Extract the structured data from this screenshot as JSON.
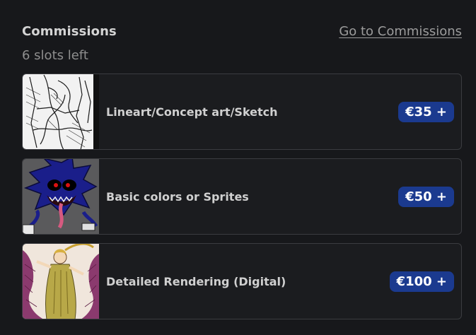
{
  "header": {
    "title": "Commissions",
    "link_label": "Go to Commissions"
  },
  "slots_text": "6 slots left",
  "commissions": [
    {
      "label": "Lineart/Concept art/Sketch",
      "price": "€35 +",
      "thumb_icon": "sketch-thumbnail"
    },
    {
      "label": "Basic colors or Sprites",
      "price": "€50 +",
      "thumb_icon": "sprite-thumbnail"
    },
    {
      "label": "Detailed Rendering (Digital)",
      "price": "€100 +",
      "thumb_icon": "rendering-thumbnail"
    }
  ],
  "colors": {
    "background": "#17181b",
    "price_badge": "#1b3a8f",
    "card_border": "#3b3c40"
  }
}
